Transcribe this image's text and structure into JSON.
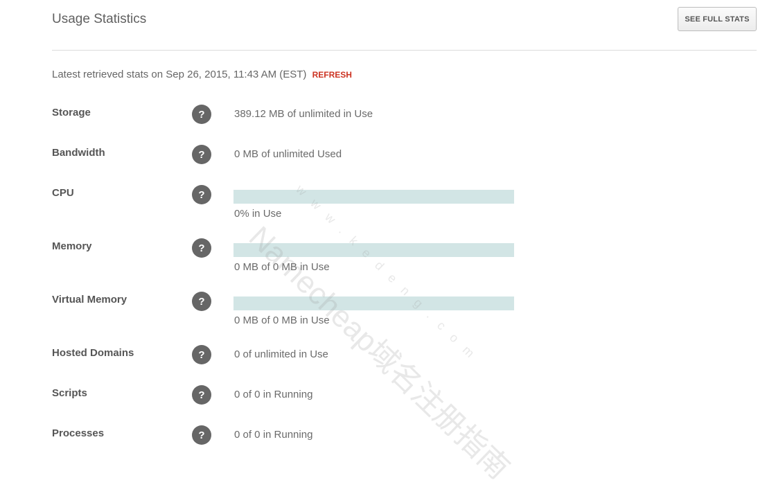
{
  "header": {
    "title": "Usage Statistics",
    "full_stats_label": "SEE FULL STATS"
  },
  "retrieved": {
    "text": "Latest retrieved stats on Sep 26, 2015, 11:43 AM (EST)",
    "refresh_label": "REFRESH"
  },
  "help_glyph": "?",
  "stats": {
    "storage": {
      "label": "Storage",
      "value": "389.12 MB of unlimited in Use"
    },
    "bandwidth": {
      "label": "Bandwidth",
      "value": "0 MB of unlimited Used"
    },
    "cpu": {
      "label": "CPU",
      "value": "0% in Use",
      "usage_fraction": 0
    },
    "memory": {
      "label": "Memory",
      "value": "0 MB of 0 MB in Use",
      "usage_fraction": 0
    },
    "virtual_memory": {
      "label": "Virtual Memory",
      "value": "0 MB of 0 MB in Use",
      "usage_fraction": 0
    },
    "hosted_domains": {
      "label": "Hosted Domains",
      "value": "0 of unlimited in Use"
    },
    "scripts": {
      "label": "Scripts",
      "value": "0 of 0 in Running"
    },
    "processes": {
      "label": "Processes",
      "value": "0 of 0 in Running"
    }
  },
  "colors": {
    "accent_refresh": "#cc3322",
    "bar_track": "#d2e5e5",
    "help_icon_bg": "#666666"
  },
  "watermark": {
    "text": "Namecheap域名注册指南",
    "sub": "www.kedeng.com"
  }
}
